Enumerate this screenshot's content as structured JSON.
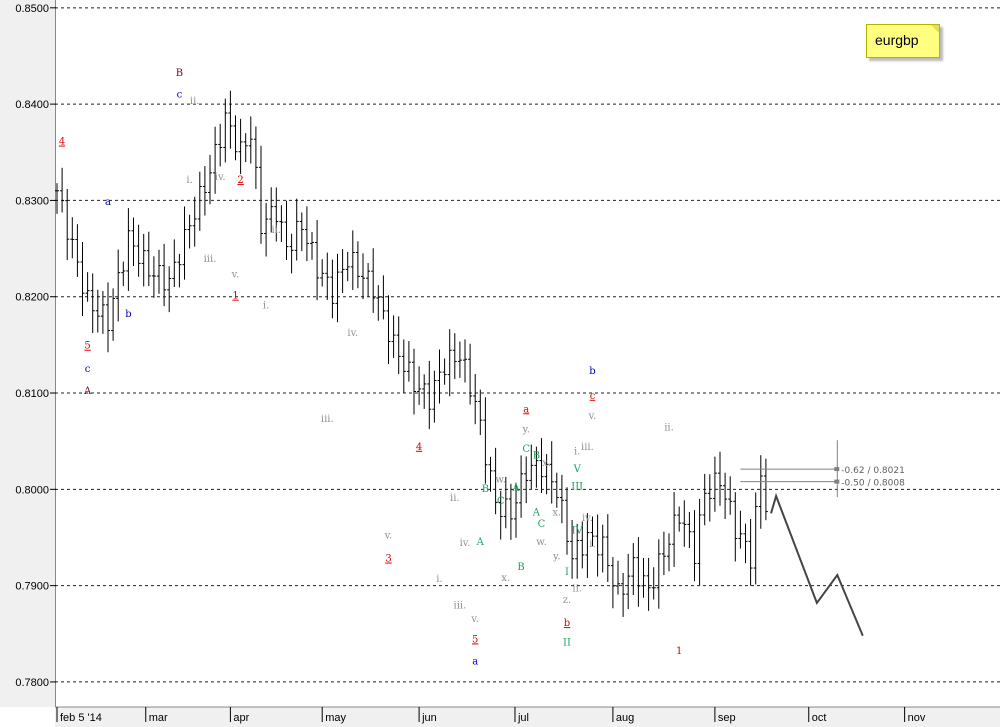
{
  "chart_data": {
    "type": "ohlc",
    "symbol": "eurgbp",
    "ylim": [
      0.7775,
      0.8505
    ],
    "y_ticks": [
      "0.7800",
      "0.7900",
      "0.8000",
      "0.8100",
      "0.8200",
      "0.8300",
      "0.8400",
      "0.8500"
    ],
    "x_labels": [
      "feb 5 '14",
      "mar",
      "apr",
      "may",
      "jun",
      "jul",
      "aug",
      "sep",
      "oct",
      "nov"
    ],
    "grid": "dashed horizontal",
    "fib_levels": [
      {
        "label": "-0.62 / 0.8021",
        "value": 0.8021
      },
      {
        "label": "-0.50 / 0.8008",
        "value": 0.8008
      }
    ],
    "projection": {
      "color": "#444444",
      "points": [
        [
          140,
          0.7975
        ],
        [
          141,
          0.7993
        ],
        [
          149,
          0.7882
        ],
        [
          153,
          0.7911
        ],
        [
          158,
          0.7848
        ]
      ]
    },
    "anchors": [
      [
        0,
        0.831
      ],
      [
        6,
        0.8195
      ],
      [
        10,
        0.8175
      ],
      [
        14,
        0.826
      ],
      [
        18,
        0.8228
      ],
      [
        22,
        0.8215
      ],
      [
        26,
        0.8275
      ],
      [
        30,
        0.833
      ],
      [
        33,
        0.8385
      ],
      [
        36,
        0.835
      ],
      [
        38,
        0.837
      ],
      [
        40,
        0.8275
      ],
      [
        43,
        0.829
      ],
      [
        45,
        0.825
      ],
      [
        48,
        0.8275
      ],
      [
        51,
        0.823
      ],
      [
        54,
        0.8205
      ],
      [
        57,
        0.824
      ],
      [
        62,
        0.821
      ],
      [
        66,
        0.815
      ],
      [
        70,
        0.811
      ],
      [
        73,
        0.8095
      ],
      [
        76,
        0.813
      ],
      [
        79,
        0.814
      ],
      [
        82,
        0.809
      ],
      [
        86,
        0.7985
      ],
      [
        89,
        0.7975
      ],
      [
        92,
        0.802
      ],
      [
        95,
        0.8025
      ],
      [
        98,
        0.8
      ],
      [
        101,
        0.793
      ],
      [
        104,
        0.795
      ],
      [
        107,
        0.794
      ],
      [
        110,
        0.789
      ],
      [
        113,
        0.792
      ],
      [
        116,
        0.7895
      ],
      [
        119,
        0.7935
      ],
      [
        122,
        0.7975
      ],
      [
        125,
        0.7935
      ],
      [
        127,
        0.7995
      ],
      [
        130,
        0.801
      ],
      [
        133,
        0.796
      ],
      [
        136,
        0.793
      ],
      [
        138,
        0.8015
      ],
      [
        139,
        0.7985
      ]
    ],
    "anchor_units": "bars since feb 5 '14 (first anchor), price",
    "labels": [
      {
        "text": "4",
        "x": 1,
        "y": 0.8358,
        "color": "#e00000",
        "underline": true
      },
      {
        "text": "5",
        "x": 6,
        "y": 0.8146,
        "color": "#e00000",
        "underline": true
      },
      {
        "text": "c",
        "x": 6,
        "y": 0.8122,
        "color": "#0000c0"
      },
      {
        "text": "A",
        "x": 6,
        "y": 0.8099,
        "color": "#800030"
      },
      {
        "text": "a",
        "x": 10,
        "y": 0.8295,
        "color": "#0000c0"
      },
      {
        "text": "b",
        "x": 14,
        "y": 0.8179,
        "color": "#0000c0"
      },
      {
        "text": "B",
        "x": 24,
        "y": 0.8429,
        "color": "#800030"
      },
      {
        "text": "c",
        "x": 24,
        "y": 0.8407,
        "color": "#0000c0"
      },
      {
        "text": "ii.",
        "x": 27,
        "y": 0.84,
        "color": "#909090"
      },
      {
        "text": "i.",
        "x": 26,
        "y": 0.8318,
        "color": "#909090"
      },
      {
        "text": "iv.",
        "x": 32,
        "y": 0.8321,
        "color": "#909090"
      },
      {
        "text": "iii.",
        "x": 30,
        "y": 0.8236,
        "color": "#909090"
      },
      {
        "text": "2",
        "x": 36,
        "y": 0.8318,
        "color": "#e00000",
        "underline": true
      },
      {
        "text": "v.",
        "x": 35,
        "y": 0.822,
        "color": "#909090"
      },
      {
        "text": "1",
        "x": 35,
        "y": 0.8198,
        "color": "#e00000",
        "underline": true
      },
      {
        "text": "ii.",
        "x": 43,
        "y": 0.8266,
        "color": "#909090"
      },
      {
        "text": "i.",
        "x": 41,
        "y": 0.8188,
        "color": "#909090"
      },
      {
        "text": "iv.",
        "x": 58,
        "y": 0.8159,
        "color": "#909090"
      },
      {
        "text": "iii.",
        "x": 53,
        "y": 0.807,
        "color": "#909090"
      },
      {
        "text": "4",
        "x": 71,
        "y": 0.8041,
        "color": "#e00000",
        "underline": true
      },
      {
        "text": "v.",
        "x": 65,
        "y": 0.7949,
        "color": "#909090"
      },
      {
        "text": "3",
        "x": 65,
        "y": 0.7925,
        "color": "#e00000",
        "underline": true
      },
      {
        "text": "ii.",
        "x": 78,
        "y": 0.7988,
        "color": "#909090"
      },
      {
        "text": "i.",
        "x": 75,
        "y": 0.7904,
        "color": "#909090"
      },
      {
        "text": "iv.",
        "x": 80,
        "y": 0.7941,
        "color": "#909090"
      },
      {
        "text": "iii.",
        "x": 79,
        "y": 0.7876,
        "color": "#909090"
      },
      {
        "text": "A",
        "x": 83,
        "y": 0.7942,
        "color": "#20a060"
      },
      {
        "text": "B",
        "x": 84,
        "y": 0.7997,
        "color": "#20a060"
      },
      {
        "text": "v.",
        "x": 82,
        "y": 0.7862,
        "color": "#909090"
      },
      {
        "text": "5",
        "x": 82,
        "y": 0.7841,
        "color": "#e00000",
        "underline": true
      },
      {
        "text": "a",
        "x": 82,
        "y": 0.7818,
        "color": "#0000c0"
      },
      {
        "text": "w.",
        "x": 87,
        "y": 0.8007,
        "color": "#909090"
      },
      {
        "text": "C",
        "x": 87,
        "y": 0.7985,
        "color": "#20a060"
      },
      {
        "text": "A",
        "x": 90,
        "y": 0.7998,
        "color": "#20a060"
      },
      {
        "text": "x.",
        "x": 88,
        "y": 0.7905,
        "color": "#909090"
      },
      {
        "text": "B",
        "x": 91,
        "y": 0.7916,
        "color": "#20a060"
      },
      {
        "text": "a",
        "x": 92,
        "y": 0.808,
        "color": "#e00000",
        "underline": true
      },
      {
        "text": "y.",
        "x": 92,
        "y": 0.8059,
        "color": "#909090"
      },
      {
        "text": "C",
        "x": 92,
        "y": 0.8039,
        "color": "#20a060"
      },
      {
        "text": "B",
        "x": 94,
        "y": 0.8032,
        "color": "#20a060"
      },
      {
        "text": "x.",
        "x": 96,
        "y": 0.8024,
        "color": "#909090"
      },
      {
        "text": "A",
        "x": 94,
        "y": 0.7973,
        "color": "#20a060"
      },
      {
        "text": "C",
        "x": 95,
        "y": 0.7961,
        "color": "#20a060"
      },
      {
        "text": "w.",
        "x": 95,
        "y": 0.7942,
        "color": "#909090"
      },
      {
        "text": "x.",
        "x": 98,
        "y": 0.7973,
        "color": "#909090"
      },
      {
        "text": "y.",
        "x": 98,
        "y": 0.7927,
        "color": "#909090"
      },
      {
        "text": "z.",
        "x": 100,
        "y": 0.7882,
        "color": "#909090"
      },
      {
        "text": "b",
        "x": 100,
        "y": 0.7858,
        "color": "#e00000",
        "underline": true
      },
      {
        "text": "II",
        "x": 100,
        "y": 0.7838,
        "color": "#20a060"
      },
      {
        "text": "ii.",
        "x": 102,
        "y": 0.7894,
        "color": "#909090"
      },
      {
        "text": "I",
        "x": 100,
        "y": 0.7911,
        "color": "#20a060"
      },
      {
        "text": "i.",
        "x": 102,
        "y": 0.8036,
        "color": "#909090"
      },
      {
        "text": "V",
        "x": 102,
        "y": 0.8018,
        "color": "#20a060"
      },
      {
        "text": "III",
        "x": 102,
        "y": 0.8,
        "color": "#20a060"
      },
      {
        "text": "IV",
        "x": 102,
        "y": 0.7954,
        "color": "#20a060"
      },
      {
        "text": "iii.",
        "x": 104,
        "y": 0.8041,
        "color": "#909090"
      },
      {
        "text": "iv.",
        "x": 104,
        "y": 0.7967,
        "color": "#909090"
      },
      {
        "text": "i.",
        "x": 105,
        "y": 0.794,
        "color": "#909090"
      },
      {
        "text": "b",
        "x": 105,
        "y": 0.812,
        "color": "#0000c0"
      },
      {
        "text": "c",
        "x": 105,
        "y": 0.8094,
        "color": "#e00000",
        "underline": true
      },
      {
        "text": "v.",
        "x": 105,
        "y": 0.8073,
        "color": "#909090"
      },
      {
        "text": "ii.",
        "x": 120,
        "y": 0.8061,
        "color": "#909090"
      },
      {
        "text": "1",
        "x": 122,
        "y": 0.7829,
        "color": "#e00000"
      }
    ]
  },
  "note": {
    "text": "eurgbp"
  },
  "colors": {
    "bars": "#000000",
    "grid": "#222222",
    "fib": "#808080",
    "axis_bg": "#f0f0f0"
  }
}
